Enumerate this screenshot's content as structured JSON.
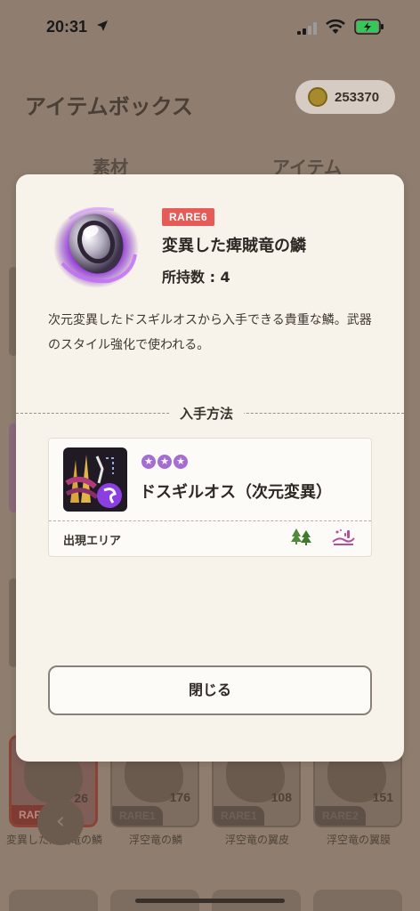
{
  "status_bar": {
    "time": "20:31"
  },
  "background": {
    "title": "アイテムボックス",
    "coins": "253370",
    "tabs": [
      "素材",
      "アイテム"
    ],
    "grid_items": [
      {
        "count": "26",
        "rarity": "RARE6",
        "name": "変異した痺賊竜の鱗"
      },
      {
        "count": "176",
        "rarity": "RARE1",
        "name": "浮空竜の鱗"
      },
      {
        "count": "108",
        "rarity": "RARE1",
        "name": "浮空竜の翼皮"
      },
      {
        "count": "151",
        "rarity": "RARE2",
        "name": "浮空竜の翼膜"
      }
    ]
  },
  "modal": {
    "rarity": "RARE6",
    "item_name": "変異した痺賊竜の鱗",
    "quantity_text": "所持数 : 4",
    "description": "次元変異したドスギルオスから入手できる貴重な鱗。武器のスタイル強化で使われる。",
    "section_label": "入手方法",
    "source": {
      "monster_name": "ドスギルオス（次元変異）",
      "stars": 3,
      "area_label": "出現エリア",
      "area_icons": [
        "forest-icon",
        "desert-icon"
      ]
    },
    "close_label": "閉じる"
  },
  "colors": {
    "rare_badge": "#e45b57",
    "star": "#a56dd1",
    "modal_bg": "#f8f3ea",
    "overlay": "#8f7e70"
  }
}
